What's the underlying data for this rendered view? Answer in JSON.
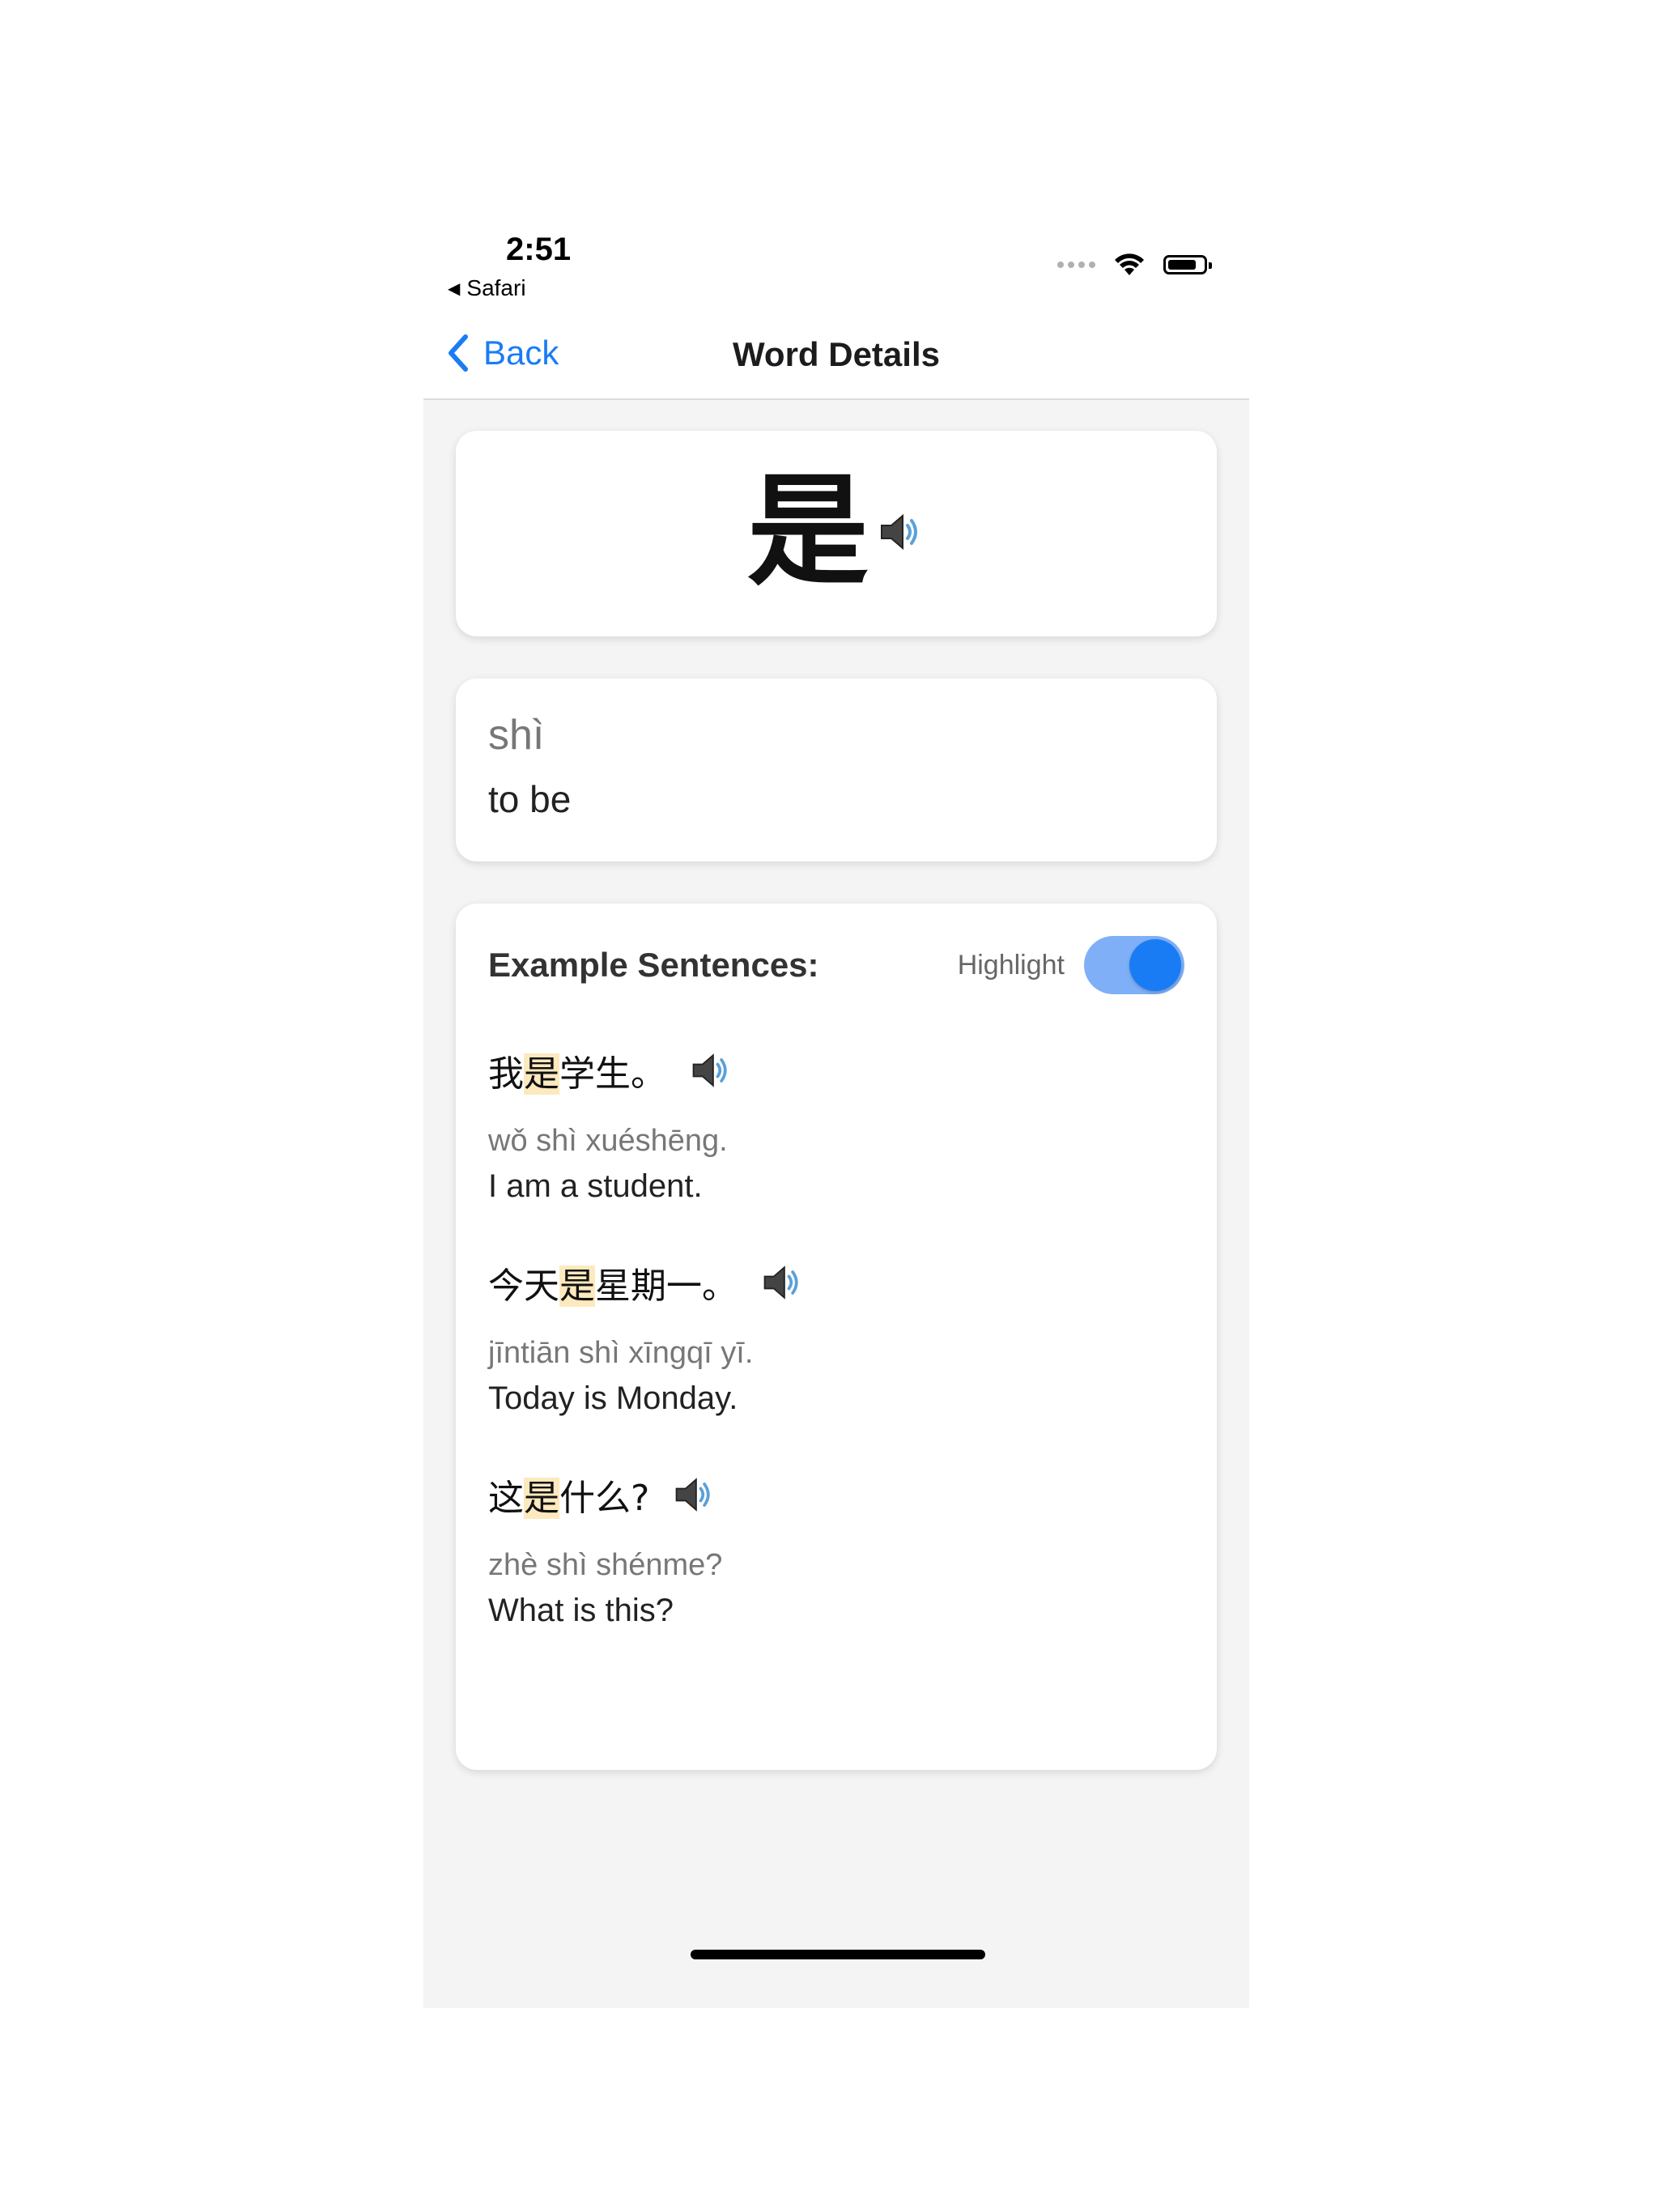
{
  "status_bar": {
    "time": "2:51",
    "back_app": "Safari"
  },
  "nav": {
    "back_label": "Back",
    "title": "Word Details"
  },
  "word": {
    "hanzi": "是",
    "pinyin": "shì",
    "meaning": "to be"
  },
  "examples": {
    "title": "Example Sentences:",
    "highlight_label": "Highlight",
    "highlight_on": true,
    "sentences": [
      {
        "before": "我",
        "highlight": "是",
        "after": "学生。",
        "pinyin": "wǒ shì xuéshēng.",
        "english": "I am a student."
      },
      {
        "before": "今天",
        "highlight": "是",
        "after": "星期一。",
        "pinyin": "jīntiān shì xīngqī yī.",
        "english": "Today is Monday."
      },
      {
        "before": "这",
        "highlight": "是",
        "after": "什么?",
        "pinyin": "zhè shì shénme?",
        "english": "What is this?"
      }
    ]
  },
  "colors": {
    "accent": "#1a7cf5",
    "highlight": "#fde9be",
    "background": "#f4f4f4"
  },
  "icons": {
    "speaker": "speaker-icon",
    "back": "chevron-left-icon"
  }
}
